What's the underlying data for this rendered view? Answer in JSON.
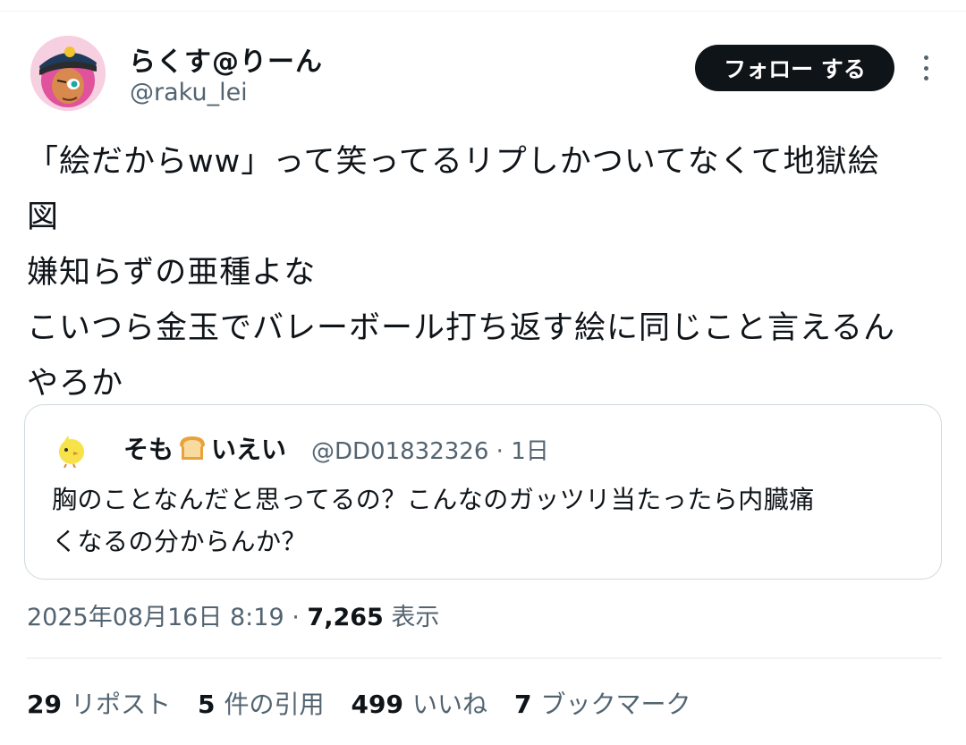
{
  "author": {
    "name": "らくす@りーん",
    "handle": "@raku_lei",
    "avatar_icon": "cartoon-avatar-pink-hair-cap"
  },
  "follow_label": "フォロー する",
  "more_icon": "vertical-ellipsis-icon",
  "body_lines": [
    "「絵だからww」って笑ってるリプしかついてなくて地獄絵",
    "図",
    "嫌知らずの亜種よな",
    "こいつら金玉でバレーボール打ち返す絵に同じこと言えるん",
    "やろか"
  ],
  "quote": {
    "avatar_icon": "yellow-chick-icon",
    "name_part1": "そも",
    "name_emoji": "bread-emoji",
    "name_part2": "いえい",
    "handle": "@DD01832326",
    "separator": "·",
    "age": "1日",
    "lines": [
      "胸のことなんだと思ってるの？こんなのガッツリ当たったら内臓痛",
      "くなるの分からんか？"
    ]
  },
  "timestamp": {
    "datetime": "2025年08月16日 8:19",
    "separator": "·",
    "views_count": "7,265",
    "views_label": "表示"
  },
  "stats": [
    {
      "count": "29",
      "label": "リポスト"
    },
    {
      "count": "5",
      "label": "件の引用"
    },
    {
      "count": "499",
      "label": "いいね"
    },
    {
      "count": "7",
      "label": "ブックマーク"
    }
  ],
  "colors": {
    "text": "#0f1419",
    "muted": "#536471",
    "border": "#cfd9de",
    "button_bg": "#0f1419"
  }
}
